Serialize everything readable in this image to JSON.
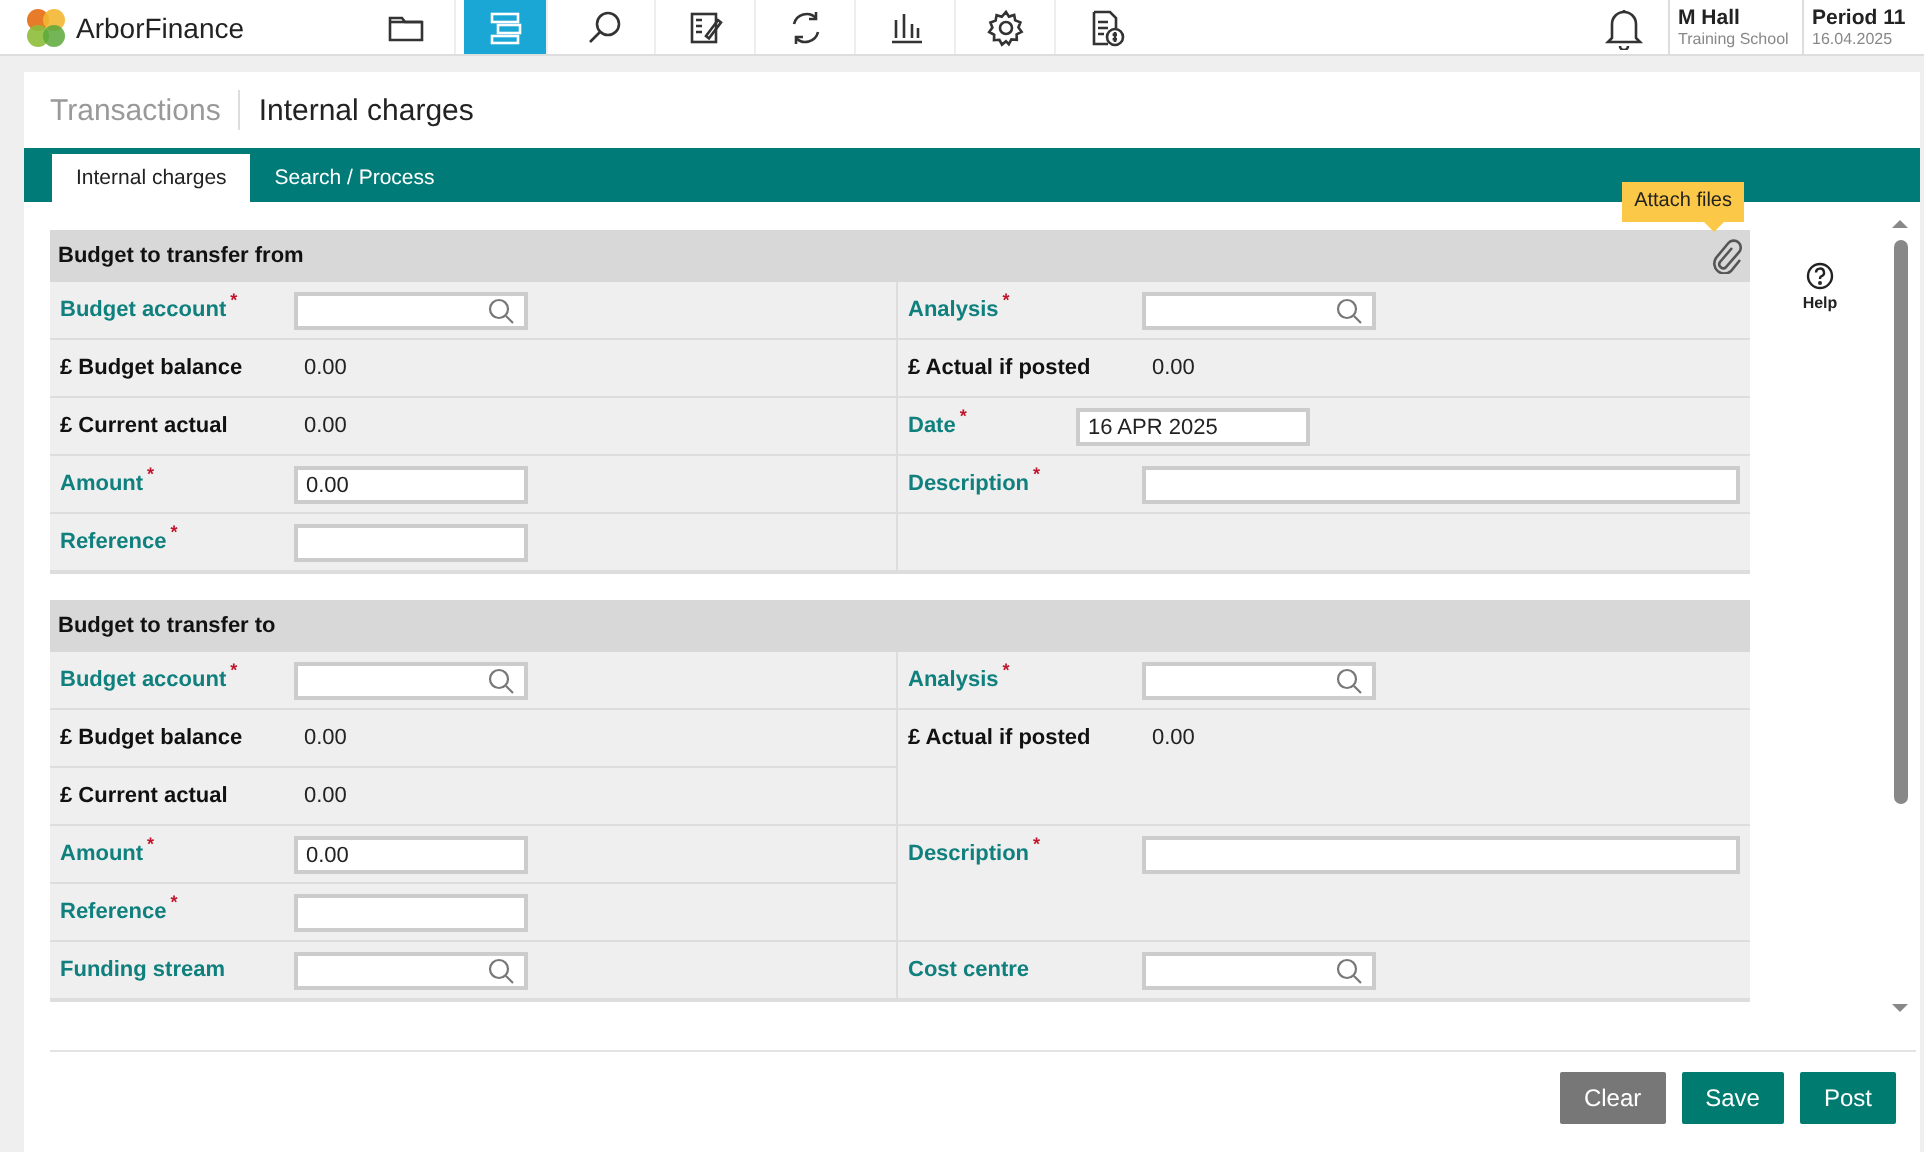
{
  "app": {
    "name": "ArborFinance"
  },
  "nav": [
    {
      "kind": "folder",
      "selected": false
    },
    {
      "kind": "list",
      "selected": true
    },
    {
      "kind": "search",
      "selected": false
    },
    {
      "kind": "form",
      "selected": false
    },
    {
      "kind": "refresh",
      "selected": false
    },
    {
      "kind": "chart",
      "selected": false
    },
    {
      "kind": "settings",
      "selected": false
    },
    {
      "kind": "invoice",
      "selected": false
    }
  ],
  "user": {
    "name": "M Hall",
    "org": "Training School"
  },
  "period": {
    "name": "Period 11",
    "date": "16.04.2025"
  },
  "breadcrumb": [
    "Transactions",
    "Internal charges"
  ],
  "tabs": [
    {
      "label": "Internal charges",
      "selected": true
    },
    {
      "label": "Search / Process",
      "selected": false
    }
  ],
  "tooltip": "Attach files",
  "help": "Help",
  "sections": [
    {
      "title": "Budget to transfer from",
      "attach": true,
      "rows": [
        {
          "left": {
            "kind": "search",
            "label": "Budget account",
            "mark": "*"
          },
          "right": {
            "kind": "search",
            "label": "Analysis",
            "mark": "*"
          }
        },
        {
          "left": {
            "kind": "readout",
            "label": "£ Budget balance",
            "value": "0.00"
          },
          "right": {
            "kind": "readout",
            "label": "£ Actual if posted",
            "value": "0.00"
          }
        },
        {
          "left": {
            "kind": "readout",
            "label": "£ Current actual",
            "value": "0.00"
          },
          "right": {
            "kind": "date",
            "label": "Date",
            "mark": "*",
            "value": "16 APR 2025"
          }
        },
        {
          "left": {
            "kind": "text",
            "label": "Amount",
            "mark": "*",
            "value": "0.00"
          },
          "right": {
            "kind": "long",
            "label": "Description",
            "mark": "*"
          }
        },
        {
          "left": {
            "kind": "text",
            "label": "Reference",
            "mark": "*"
          },
          "right": {
            "kind": "blank"
          }
        }
      ]
    },
    {
      "title": "Budget to transfer to",
      "rows": [
        {
          "left": {
            "kind": "search",
            "label": "Budget account",
            "mark": "*"
          },
          "right": {
            "kind": "search",
            "label": "Analysis",
            "mark": "*"
          }
        },
        {
          "left": {
            "kind": "readout",
            "label": "£ Budget balance",
            "value": "0.00"
          },
          "right": {
            "kind": "readout",
            "label": "£ Actual if posted",
            "value": "0.00"
          }
        },
        {
          "left": {
            "kind": "readout",
            "label": "£ Current actual",
            "value": "0.00"
          }
        },
        {
          "left": {
            "kind": "text",
            "label": "Amount",
            "mark": "*",
            "value": "0.00"
          },
          "right": {
            "kind": "long",
            "label": "Description",
            "mark": "*"
          }
        },
        {
          "left": {
            "kind": "text",
            "label": "Reference",
            "mark": "*"
          }
        },
        {
          "left": {
            "kind": "search",
            "label": "Funding stream"
          },
          "right": {
            "kind": "search",
            "label": "Cost centre"
          }
        }
      ]
    }
  ],
  "buttons": [
    {
      "label": "Clear",
      "kind": "secondary"
    },
    {
      "label": "Save",
      "kind": "primary"
    },
    {
      "label": "Post",
      "kind": "primary"
    }
  ]
}
